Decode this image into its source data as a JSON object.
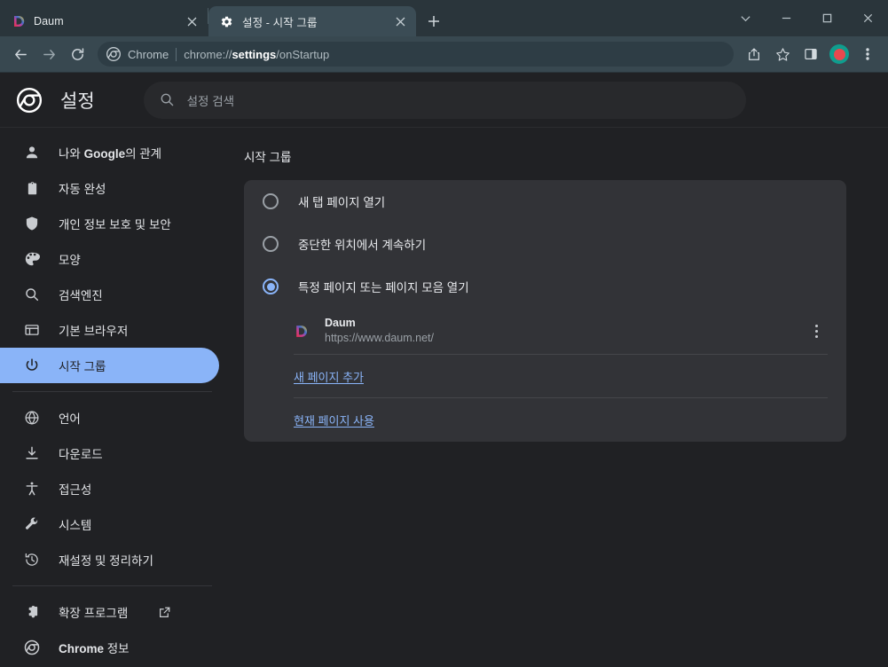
{
  "browser": {
    "tabs": [
      {
        "title": "Daum",
        "favicon": "daum-favicon",
        "active": false,
        "close_label": "×"
      },
      {
        "title": "설정 - 시작 그룹",
        "favicon": "gear-icon",
        "active": true,
        "close_label": "×"
      }
    ],
    "new_tab_label": "+",
    "window_controls": {
      "tab_search": "chevron-down-icon",
      "minimize": "minimize-icon",
      "maximize": "maximize-icon",
      "close": "close-icon"
    },
    "toolbar": {
      "back": "back-arrow-icon",
      "forward": "forward-arrow-icon",
      "reload": "reload-icon",
      "omnibox": {
        "icon": "chrome-logo-icon",
        "label": "Chrome",
        "url_prefix": "chrome://",
        "url_bold": "settings",
        "url_suffix": "/onStartup"
      },
      "share": "share-icon",
      "bookmark": "star-icon",
      "side_panel": "side-panel-icon",
      "profile": "avatar",
      "menu": "three-dot-menu-icon"
    }
  },
  "settings": {
    "header": {
      "logo": "chrome-logo-icon",
      "title": "설정",
      "search_placeholder": "설정 검색",
      "search_icon": "search-icon"
    },
    "sidebar": {
      "items": [
        {
          "label": "나와 Google의 관계",
          "icon": "person-icon",
          "selected": false
        },
        {
          "label": "자동 완성",
          "icon": "clipboard-icon",
          "selected": false
        },
        {
          "label": "개인 정보 보호 및 보안",
          "icon": "shield-icon",
          "selected": false
        },
        {
          "label": "모양",
          "icon": "palette-icon",
          "selected": false
        },
        {
          "label": "검색엔진",
          "icon": "search-icon",
          "selected": false
        },
        {
          "label": "기본 브라우저",
          "icon": "browser-window-icon",
          "selected": false
        },
        {
          "label": "시작 그룹",
          "icon": "power-icon",
          "selected": true
        }
      ],
      "items2": [
        {
          "label": "언어",
          "icon": "globe-icon"
        },
        {
          "label": "다운로드",
          "icon": "download-icon"
        },
        {
          "label": "접근성",
          "icon": "accessibility-icon"
        },
        {
          "label": "시스템",
          "icon": "wrench-icon"
        },
        {
          "label": "재설정 및 정리하기",
          "icon": "history-restore-icon"
        }
      ],
      "items3": [
        {
          "label": "확장 프로그램",
          "icon": "puzzle-icon",
          "external": true
        },
        {
          "label": "Chrome 정보",
          "icon": "chrome-logo-icon",
          "external": false
        }
      ]
    },
    "main": {
      "section_title": "시작 그룹",
      "options": [
        {
          "label": "새 탭 페이지 열기",
          "selected": false
        },
        {
          "label": "중단한 위치에서 계속하기",
          "selected": false
        },
        {
          "label": "특정 페이지 또는 페이지 모음 열기",
          "selected": true
        }
      ],
      "startup_pages": [
        {
          "name": "Daum",
          "url": "https://www.daum.net/",
          "favicon": "daum-favicon",
          "menu": "three-dot-menu-icon"
        }
      ],
      "add_page_link": "새 페이지 추가",
      "use_current_link": "현재 페이지 사용"
    }
  },
  "colors": {
    "accent_blue": "#8ab4f8",
    "page_bg": "#202124",
    "card_bg": "#323337",
    "tabstrip_bg": "#2a353b",
    "toolbar_bg": "#384850"
  }
}
